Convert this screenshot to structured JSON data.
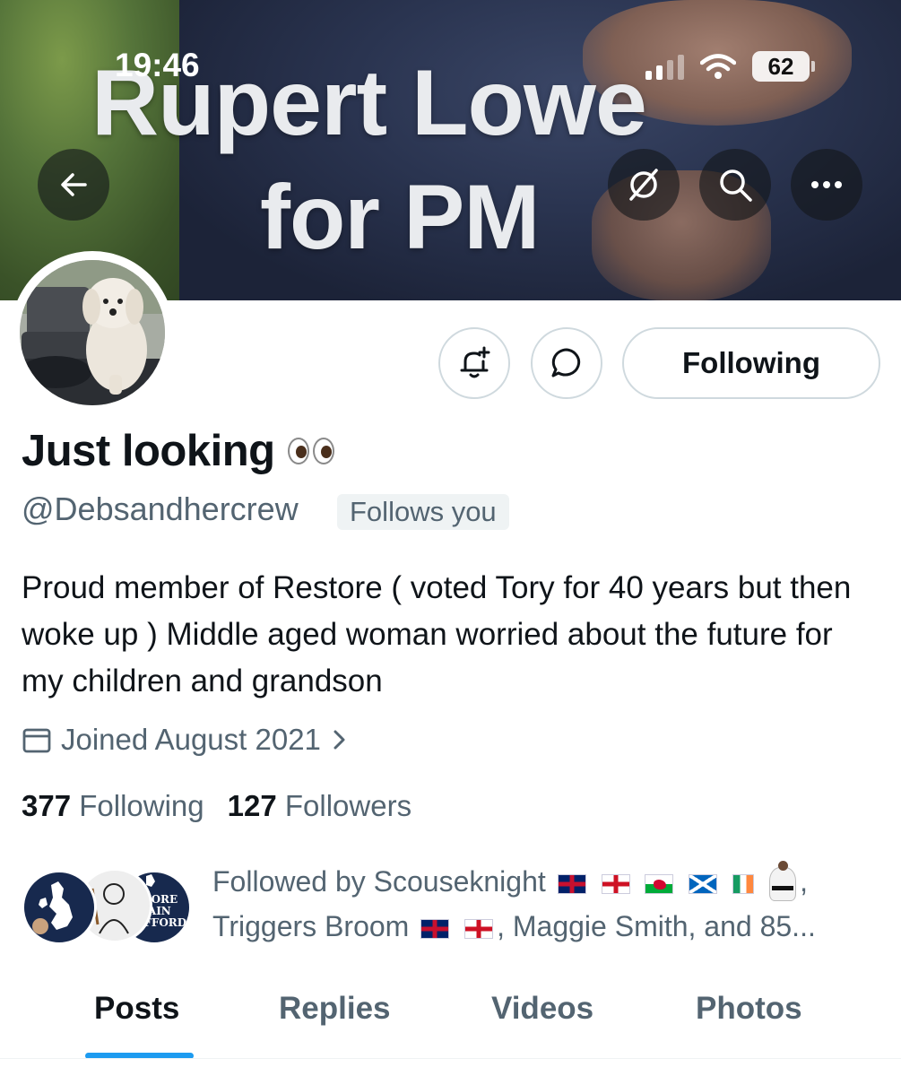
{
  "status_bar": {
    "time": "19:46",
    "battery": "62"
  },
  "banner": {
    "line1": "Rupert Lowe",
    "line2": "for PM"
  },
  "actions": {
    "following_label": "Following"
  },
  "profile": {
    "display_name": "Just looking",
    "handle": "@Debsandhercrew",
    "follows_you": "Follows you",
    "bio": "Proud member of Restore ( voted Tory for 40 years but then woke up ) Middle aged woman worried about the future for my children and grandson",
    "joined": "Joined August 2021"
  },
  "stats": {
    "following_count": "377",
    "following_label": "Following",
    "followers_count": "127",
    "followers_label": "Followers"
  },
  "followed_by": {
    "prefix": "Followed by Scouseknight",
    "trailing_comma": ",",
    "second_name": "Triggers Broom",
    "rest": ", Maggie Smith, and 85...",
    "avatar3_text": "STORE\nITAIN\nAFFORD"
  },
  "tabs": [
    {
      "label": "Posts"
    },
    {
      "label": "Replies"
    },
    {
      "label": "Videos"
    },
    {
      "label": "Photos"
    }
  ],
  "colors": {
    "accent": "#1d9bf0",
    "secondary_text": "#536471",
    "primary_text": "#0f1419"
  }
}
